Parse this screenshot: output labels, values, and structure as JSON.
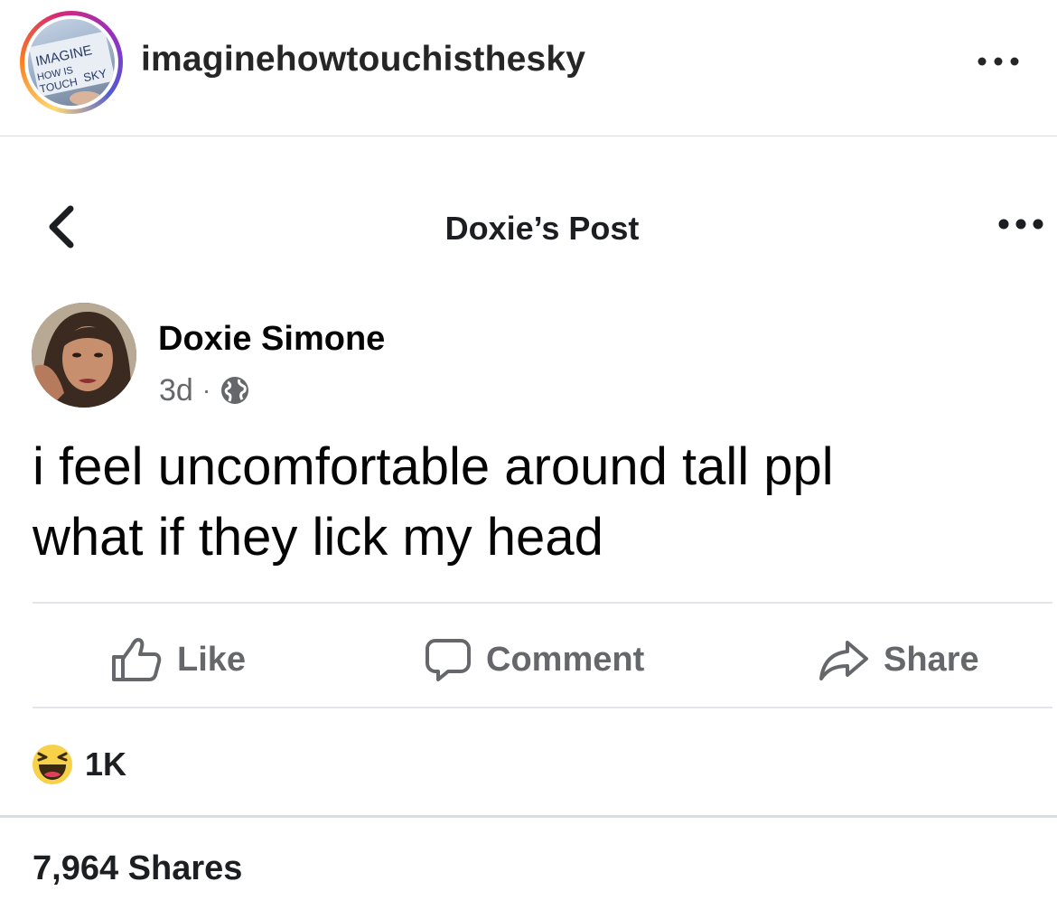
{
  "instagram": {
    "username": "imaginehowtouchisthesky",
    "avatar_sign_text": [
      "IMAGINE",
      "HOW IS",
      "TOUCH",
      "SKY"
    ]
  },
  "facebook_nav": {
    "title": "Doxie’s Post"
  },
  "post": {
    "author": "Doxie Simone",
    "time": "3d",
    "separator": "·",
    "text_lines": [
      "i feel uncomfortable around tall ppl",
      "what if they lick my head"
    ]
  },
  "actions": {
    "like": "Like",
    "comment": "Comment",
    "share": "Share"
  },
  "reactions": {
    "count": "1K"
  },
  "shares": {
    "label": "7,964 Shares"
  },
  "colors": {
    "secondary_text": "#65676b",
    "primary_text": "#050505",
    "divider": "#e4e6eb"
  }
}
